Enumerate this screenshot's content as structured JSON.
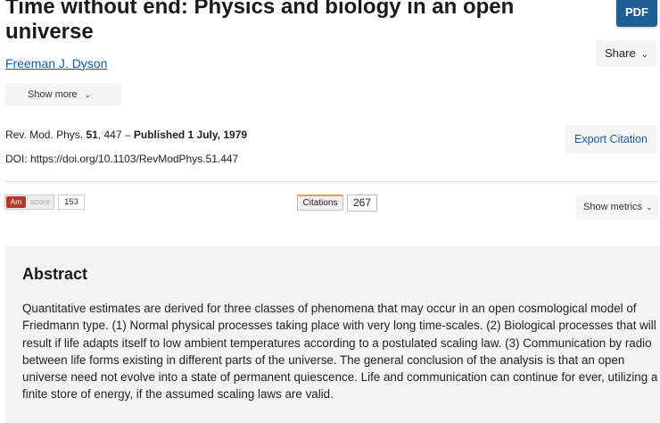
{
  "article": {
    "title": "Time without end: Physics and biology in an open universe",
    "author": "Freeman J. Dyson",
    "journal": "Rev. Mod. Phys.",
    "volume": "51",
    "pages": ", 447 – ",
    "published": "Published 1 July, 1979",
    "doi": "DOI: https://doi.org/10.1103/RevModPhys.51.447"
  },
  "actions": {
    "pdf_label": "PDF",
    "share_label": "Share",
    "show_more_label": "Show more",
    "export_citation_label": "Export Citation",
    "show_metrics_label": "Show metrics"
  },
  "metrics": {
    "altmetric_badge": "Am",
    "altmetric_score_label": "score",
    "altmetric_score": "153",
    "citations_label": "Citations",
    "citations_count": "267"
  },
  "abstract": {
    "heading": "Abstract",
    "text": "Quantitative estimates are derived for three classes of phenomena that may occur in an open cosmological model of Friedmann type. (1) Normal physical processes taking place with very long time-scales. (2) Biological processes that will result if life adapts itself to low ambient temperatures according to a postulated scaling law. (3) Communication by radio between life forms existing in different parts of the universe. The general conclusion of the analysis is that an open universe need not evolve into a state of permanent quiescence. Life and communication can continue for ever, utilizing a finite store of energy, if the assumed scaling laws are valid."
  },
  "colors": {
    "pdf_button": "#1f5f96",
    "link": "#1a5a95",
    "abstract_background": "#f4f4f4",
    "altmetric_red": "#b23a2c"
  },
  "icons": {
    "chevron": "chevron-down-icon"
  }
}
